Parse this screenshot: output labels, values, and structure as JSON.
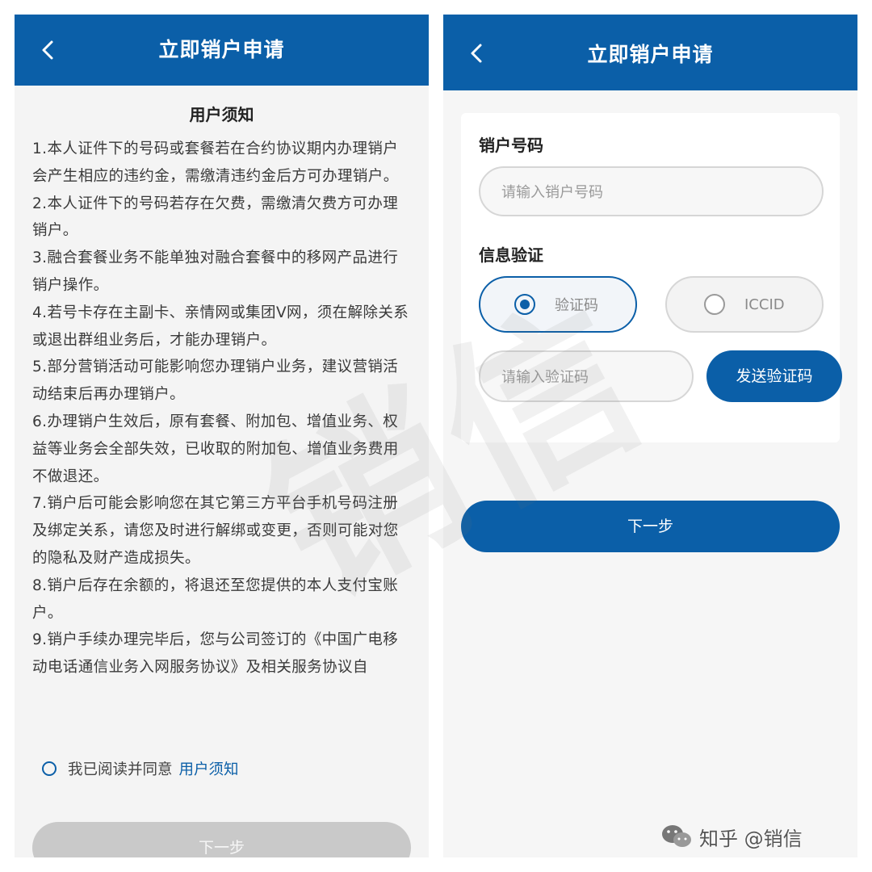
{
  "left": {
    "header": {
      "title": "立即销户申请"
    },
    "notice_title": "用户须知",
    "notice_items": [
      "1.本人证件下的号码或套餐若在合约协议期内办理销户会产生相应的违约金，需缴清违约金后方可办理销户。",
      "2.本人证件下的号码若存在欠费，需缴清欠费方可办理销户。",
      "3.融合套餐业务不能单独对融合套餐中的移网产品进行销户操作。",
      "4.若号卡存在主副卡、亲情网或集团V网，须在解除关系或退出群组业务后，才能办理销户。",
      "5.部分营销活动可能影响您办理销户业务，建议营销活动结束后再办理销户。",
      "6.办理销户生效后，原有套餐、附加包、增值业务、权益等业务会全部失效，已收取的附加包、增值业务费用不做退还。",
      "7.销户后可能会影响您在其它第三方平台手机号码注册及绑定关系，请您及时进行解绑或变更，否则可能对您的隐私及财产造成损失。",
      "8.销户后存在余额的，将退还至您提供的本人支付宝账户。",
      "9.销户手续办理完毕后，您与公司签订的《中国广电移动电话通信业务入网服务协议》及相关服务协议自"
    ],
    "agree_text": "我已阅读并同意",
    "agree_link": "用户须知",
    "next_button": "下一步"
  },
  "right": {
    "header": {
      "title": "立即销户申请"
    },
    "number_label": "销户号码",
    "number_placeholder": "请输入销户号码",
    "verify_label": "信息验证",
    "options": [
      {
        "label": "验证码",
        "selected": true
      },
      {
        "label": "ICCID",
        "selected": false
      }
    ],
    "code_placeholder": "请输入验证码",
    "send_code_button": "发送验证码",
    "next_button": "下一步"
  },
  "watermark": "销信",
  "credit": "知乎 @销信",
  "colors": {
    "primary": "#0b5fa8",
    "disabled": "#c9c9c9",
    "background": "#f4f4f4"
  },
  "icons": {
    "back": "chevron-left-icon",
    "credit": "wechat-icon"
  }
}
